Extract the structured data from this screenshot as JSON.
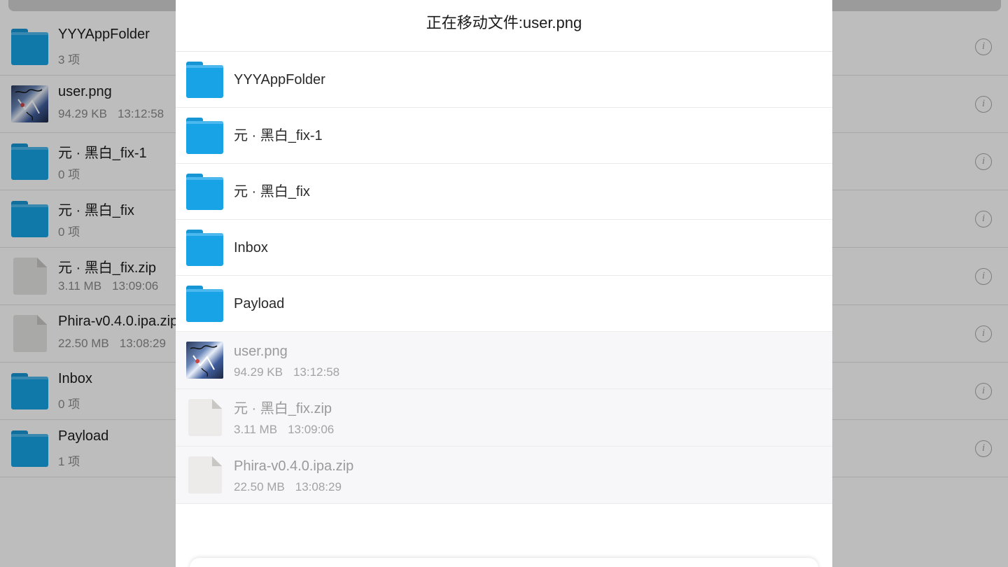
{
  "background_list": {
    "items": [
      {
        "name": "YYYAppFolder",
        "meta": [
          "3 项"
        ],
        "icon": "folder-icon"
      },
      {
        "name": "user.png",
        "meta": [
          "94.29 KB",
          "13:12:58"
        ],
        "icon": "image-thumbnail"
      },
      {
        "name": "元 · 黑白_fix-1",
        "meta": [
          "0 项"
        ],
        "icon": "folder-icon"
      },
      {
        "name": "元 · 黑白_fix",
        "meta": [
          "0 项"
        ],
        "icon": "folder-icon"
      },
      {
        "name": "元 · 黑白_fix.zip",
        "meta": [
          "3.11 MB",
          "13:09:06"
        ],
        "icon": "document-icon"
      },
      {
        "name": "Phira-v0.4.0.ipa.zip",
        "meta": [
          "22.50 MB",
          "13:08:29"
        ],
        "icon": "document-icon"
      },
      {
        "name": "Inbox",
        "meta": [
          "0 项"
        ],
        "icon": "folder-icon"
      },
      {
        "name": "Payload",
        "meta": [
          "1 项"
        ],
        "icon": "folder-icon"
      }
    ],
    "info_glyph": "i"
  },
  "modal": {
    "title": "正在移动文件:user.png",
    "folders": [
      {
        "name": "YYYAppFolder"
      },
      {
        "name": "元 · 黑白_fix-1"
      },
      {
        "name": "元 · 黑白_fix"
      },
      {
        "name": "Inbox"
      },
      {
        "name": "Payload"
      }
    ],
    "files": [
      {
        "name": "user.png",
        "size": "94.29 KB",
        "time": "13:12:58",
        "icon": "image-thumbnail"
      },
      {
        "name": "元 · 黑白_fix.zip",
        "size": "3.11 MB",
        "time": "13:09:06",
        "icon": "document-icon"
      },
      {
        "name": "Phira-v0.4.0.ipa.zip",
        "size": "22.50 MB",
        "time": "13:08:29",
        "icon": "document-icon"
      }
    ]
  },
  "colors": {
    "folder_blue": "#17a3e6",
    "dim_overlay": "rgba(0,0,0,0.26)",
    "disabled_row_bg": "#f7f7f9"
  }
}
